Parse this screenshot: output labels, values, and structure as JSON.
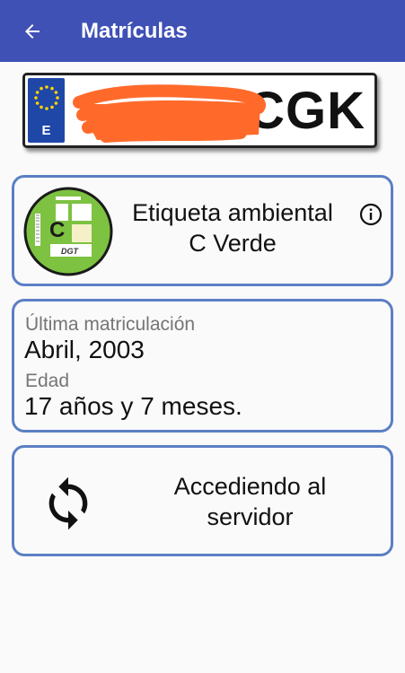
{
  "appbar": {
    "title": "Matrículas"
  },
  "plate": {
    "country_code": "E",
    "visible_letters": "CGK"
  },
  "environmental": {
    "title": "Etiqueta ambiental",
    "label": "C Verde",
    "sticker": {
      "letter": "C",
      "brand": "DGT"
    }
  },
  "registration": {
    "last_label": "Última matriculación",
    "last_value": "Abril, 2003",
    "age_label": "Edad",
    "age_value": "17 años y 7 meses."
  },
  "server": {
    "line1": "Accediendo al",
    "line2": "servidor"
  },
  "colors": {
    "primary": "#3f51b5",
    "card_border": "#5b7fc4",
    "sticker_green": "#7dc241",
    "eu_blue": "#1f47a8",
    "redaction": "#ff6a2b"
  }
}
